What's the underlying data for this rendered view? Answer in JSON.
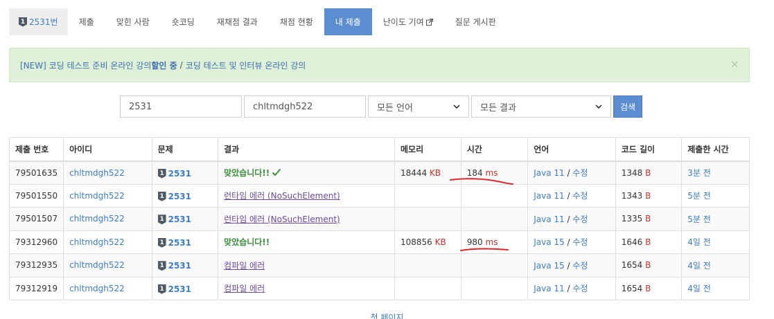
{
  "tabs": {
    "problem": "2531번",
    "problem_tier": "1",
    "submit": "제출",
    "solvers": "맞힌 사람",
    "shortcoding": "숏코딩",
    "rejudge": "재채점 결과",
    "status": "채점 현황",
    "my_submissions": "내 제출",
    "difficulty": "난이도 기여",
    "board": "질문 게시판"
  },
  "alert": {
    "prefix": "[NEW] 코딩 테스트 준비 온라인 강의 ",
    "highlight": "할인 중",
    "separator": "/",
    "suffix": "코딩 테스트 및 인터뷰 온라인 강의",
    "close": "×"
  },
  "search": {
    "problem_id": "2531",
    "user_id": "chltmdgh522",
    "language": "모든 언어",
    "result": "모든 결과",
    "button": "검색"
  },
  "table": {
    "headers": [
      "제출 번호",
      "아이디",
      "문제",
      "결과",
      "메모리",
      "시간",
      "언어",
      "코드 길이",
      "제출한 시간"
    ],
    "rows": [
      {
        "id": "79501635",
        "user": "chltmdgh522",
        "problem": "2531",
        "result": "맞았습니다!!",
        "result_type": "ok",
        "check": true,
        "memory": "18444",
        "memory_unit": "KB",
        "time": "184",
        "time_unit": "ms",
        "lang": "Java 11",
        "edit": "수정",
        "length": "1348",
        "length_unit": "B",
        "submitted": "3분 전"
      },
      {
        "id": "79501550",
        "user": "chltmdgh522",
        "problem": "2531",
        "result": "런타임 에러 (NoSuchElement)",
        "result_type": "rte",
        "check": false,
        "memory": "",
        "memory_unit": "",
        "time": "",
        "time_unit": "",
        "lang": "Java 11",
        "edit": "수정",
        "length": "1343",
        "length_unit": "B",
        "submitted": "5분 전"
      },
      {
        "id": "79501507",
        "user": "chltmdgh522",
        "problem": "2531",
        "result": "런타임 에러 (NoSuchElement)",
        "result_type": "rte",
        "check": false,
        "memory": "",
        "memory_unit": "",
        "time": "",
        "time_unit": "",
        "lang": "Java 11",
        "edit": "수정",
        "length": "1335",
        "length_unit": "B",
        "submitted": "5분 전"
      },
      {
        "id": "79312960",
        "user": "chltmdgh522",
        "problem": "2531",
        "result": "맞았습니다!!",
        "result_type": "ok",
        "check": false,
        "memory": "108856",
        "memory_unit": "KB",
        "time": "980",
        "time_unit": "ms",
        "lang": "Java 15",
        "edit": "수정",
        "length": "1646",
        "length_unit": "B",
        "submitted": "4일 전"
      },
      {
        "id": "79312935",
        "user": "chltmdgh522",
        "problem": "2531",
        "result": "컴파일 에러",
        "result_type": "ce",
        "check": false,
        "memory": "",
        "memory_unit": "",
        "time": "",
        "time_unit": "",
        "lang": "Java 15",
        "edit": "수정",
        "length": "1654",
        "length_unit": "B",
        "submitted": "4일 전"
      },
      {
        "id": "79312919",
        "user": "chltmdgh522",
        "problem": "2531",
        "result": "컴파일 에러",
        "result_type": "ce",
        "check": false,
        "memory": "",
        "memory_unit": "",
        "time": "",
        "time_unit": "",
        "lang": "Java 11",
        "edit": "수정",
        "length": "1654",
        "length_unit": "B",
        "submitted": "4일 전"
      }
    ]
  },
  "pager": {
    "first": "첫 페이지"
  },
  "colors": {
    "accent": "#5b8dd1",
    "link": "#3d7dc4",
    "ok": "#3c8d3c",
    "error": "#6b4a9e",
    "unit": "#c9302c",
    "annotation": "#d9262b"
  }
}
